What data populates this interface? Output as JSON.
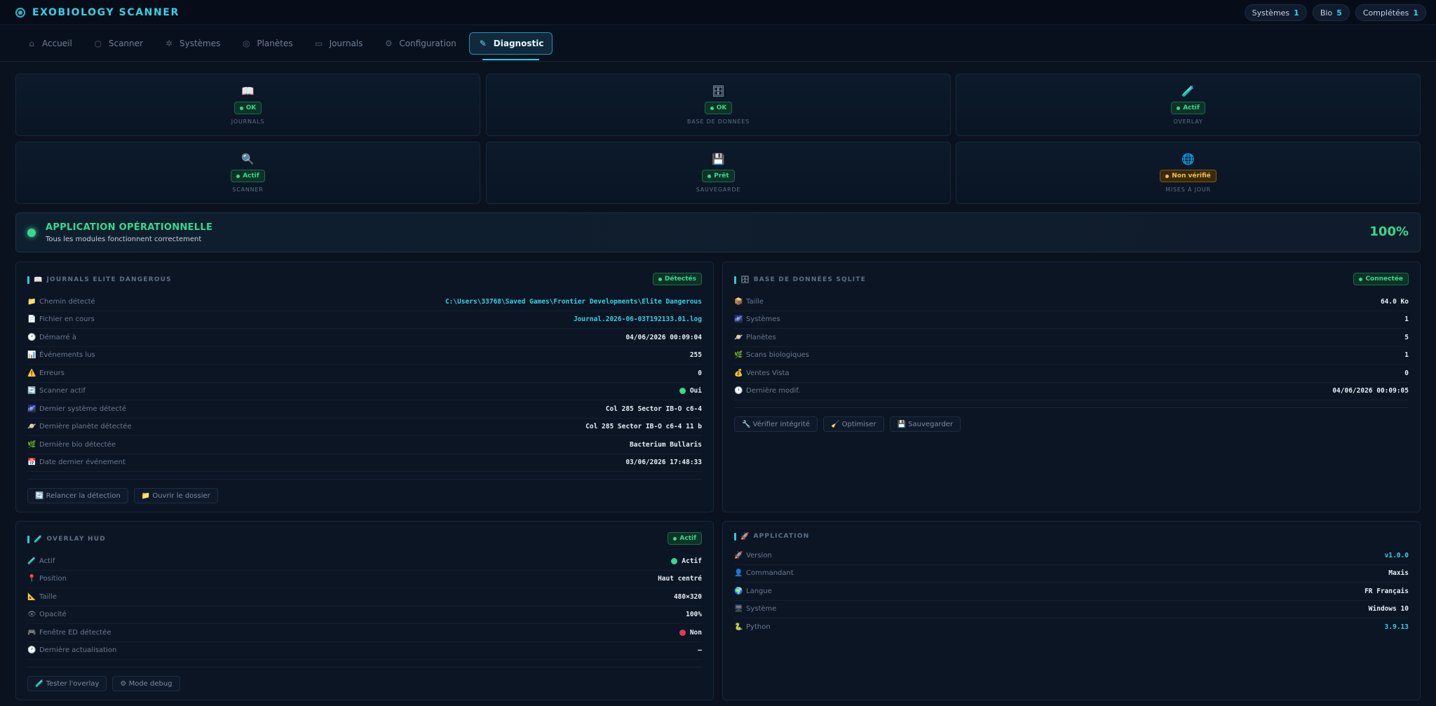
{
  "app": {
    "title": "EXOBIOLOGY SCANNER"
  },
  "header_stats": [
    {
      "label": "Systèmes",
      "value": "1"
    },
    {
      "label": "Bio",
      "value": "5"
    },
    {
      "label": "Complétées",
      "value": "1"
    }
  ],
  "tabs": [
    {
      "label": "Accueil",
      "icon": "home-icon"
    },
    {
      "label": "Scanner",
      "icon": "search-icon"
    },
    {
      "label": "Systèmes",
      "icon": "star-icon"
    },
    {
      "label": "Planètes",
      "icon": "planet-icon"
    },
    {
      "label": "Journals",
      "icon": "document-icon"
    },
    {
      "label": "Configuration",
      "icon": "gear-icon"
    },
    {
      "label": "Diagnostic",
      "icon": "wrench-icon",
      "active": true
    }
  ],
  "status_cards": [
    {
      "icon": "📖",
      "status": "OK",
      "label": "JOURNALS"
    },
    {
      "icon": "🗄",
      "status": "OK",
      "label": "BASE DE DONNÉES"
    },
    {
      "icon": "🧪",
      "status": "Actif",
      "label": "OVERLAY"
    },
    {
      "icon": "🔍",
      "status": "Actif",
      "label": "SCANNER"
    },
    {
      "icon": "💾",
      "status": "Prêt",
      "label": "SAUVEGARDE"
    },
    {
      "icon": "🌐",
      "status": "Non vérifié",
      "label": "MISES À JOUR"
    }
  ],
  "banner": {
    "title": "APPLICATION OPÉRATIONNELLE",
    "subtitle": "Tous les modules fonctionnent correctement",
    "percent": "100%"
  },
  "journals": {
    "title": "JOURNALS ELITE DANGEROUS",
    "badge": "Détectés",
    "rows": [
      {
        "icon": "📁",
        "label": "Chemin détecté",
        "value": "C:\\Users\\33768\\Saved Games\\Frontier Developments\\Elite Dangerous"
      },
      {
        "icon": "📄",
        "label": "Fichier en cours",
        "value": "Journal.2026-06-03T192133.01.log"
      },
      {
        "icon": "🕐",
        "label": "Démarré à",
        "value": "04/06/2026 00:09:04"
      },
      {
        "icon": "📊",
        "label": "Événements lus",
        "value": "255"
      },
      {
        "icon": "⚠️",
        "label": "Erreurs",
        "value": "0"
      },
      {
        "icon": "🔄",
        "label": "Scanner actif",
        "value": "Oui"
      },
      {
        "icon": "🌌",
        "label": "Dernier système détecté",
        "value": "Col 285 Sector IB-O c6-4"
      },
      {
        "icon": "🪐",
        "label": "Dernière planète détectée",
        "value": "Col 285 Sector IB-O c6-4 11 b"
      },
      {
        "icon": "🌿",
        "label": "Dernière bio détectée",
        "value": "Bacterium Bullaris"
      },
      {
        "icon": "📅",
        "label": "Date dernier événement",
        "value": "03/06/2026 17:48:33"
      }
    ],
    "buttons": [
      "🔄 Relancer la détection",
      "📁 Ouvrir le dossier"
    ]
  },
  "database": {
    "title": "BASE DE DONNÉES SQLITE",
    "badge": "Connectée",
    "rows": [
      {
        "icon": "📦",
        "label": "Taille",
        "value": "64.0 Ko"
      },
      {
        "icon": "🌌",
        "label": "Systèmes",
        "value": "1"
      },
      {
        "icon": "🪐",
        "label": "Planètes",
        "value": "5"
      },
      {
        "icon": "🌿",
        "label": "Scans biologiques",
        "value": "1"
      },
      {
        "icon": "💰",
        "label": "Ventes Vista",
        "value": "0"
      },
      {
        "icon": "🕐",
        "label": "Dernière modif.",
        "value": "04/06/2026 00:09:05"
      }
    ],
    "buttons": [
      "🔧 Vérifier intégrité",
      "🧹 Optimiser",
      "💾 Sauvegarder"
    ]
  },
  "overlay": {
    "title": "OVERLAY HUD",
    "badge": "Actif",
    "rows": [
      {
        "icon": "🧪",
        "label": "Actif",
        "value": "Actif"
      },
      {
        "icon": "📍",
        "label": "Position",
        "value": "Haut centré"
      },
      {
        "icon": "📐",
        "label": "Taille",
        "value": "480×320"
      },
      {
        "icon": "👁",
        "label": "Opacité",
        "value": "100%"
      },
      {
        "icon": "🎮",
        "label": "Fenêtre ED détectée",
        "value": "Non"
      },
      {
        "icon": "🕐",
        "label": "Dernière actualisation",
        "value": "—"
      }
    ],
    "buttons": [
      "🧪 Tester l'overlay",
      "⚙ Mode debug"
    ]
  },
  "application": {
    "title": "APPLICATION",
    "rows": [
      {
        "icon": "🚀",
        "label": "Version",
        "value": "v1.0.0"
      },
      {
        "icon": "👤",
        "label": "Commandant",
        "value": "Maxis"
      },
      {
        "icon": "🌍",
        "label": "Langue",
        "value": "FR Français"
      },
      {
        "icon": "🖥",
        "label": "Système",
        "value": "Windows 10"
      },
      {
        "icon": "🐍",
        "label": "Python",
        "value": "3.9.13"
      }
    ]
  },
  "colors": {
    "accent": "#36d0e6",
    "ok": "#38d98a",
    "warn": "#f3c14a",
    "error": "#e6395a",
    "background": "#0a1220"
  }
}
